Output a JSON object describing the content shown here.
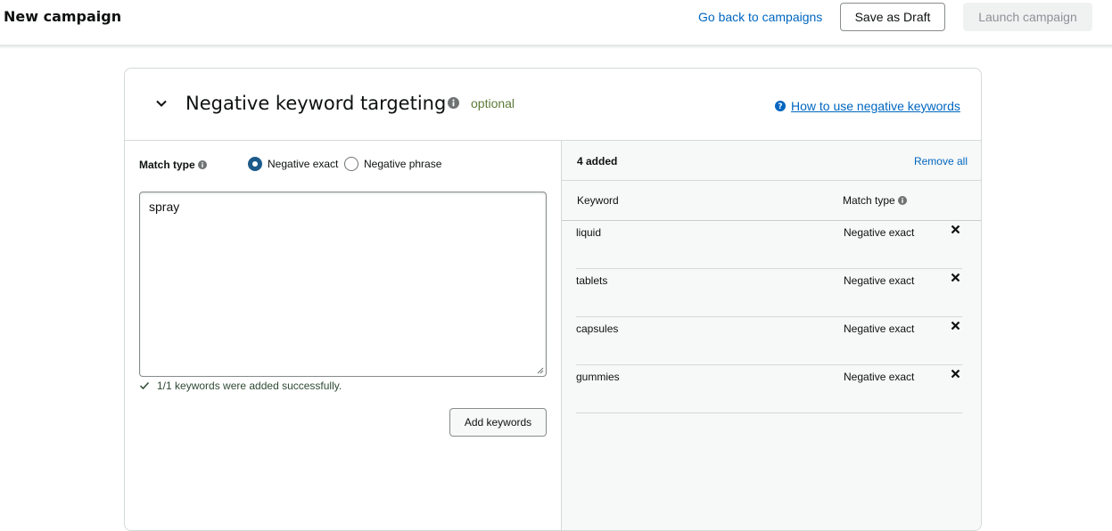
{
  "header": {
    "title": "New campaign",
    "back_link": "Go back to campaigns",
    "save_draft": "Save as Draft",
    "launch": "Launch campaign"
  },
  "section": {
    "title": "Negative keyword targeting",
    "optional": "optional",
    "help_link": "How to use negative keywords"
  },
  "form": {
    "match_type_label": "Match type",
    "radio_exact": "Negative exact",
    "radio_phrase": "Negative phrase",
    "selected": "Negative exact",
    "textarea_value": "spray",
    "success_message": "1/1 keywords were added successfully.",
    "add_button": "Add keywords"
  },
  "added_panel": {
    "count_label": "4 added",
    "remove_all": "Remove all",
    "col_keyword": "Keyword",
    "col_match_type": "Match type",
    "rows": [
      {
        "keyword": "liquid",
        "match_type": "Negative exact"
      },
      {
        "keyword": "tablets",
        "match_type": "Negative exact"
      },
      {
        "keyword": "capsules",
        "match_type": "Negative exact"
      },
      {
        "keyword": "gummies",
        "match_type": "Negative exact"
      }
    ]
  },
  "colors": {
    "link": "#0066c0",
    "radio_selected": "#1d5a8a",
    "optional": "#5c7a37"
  }
}
